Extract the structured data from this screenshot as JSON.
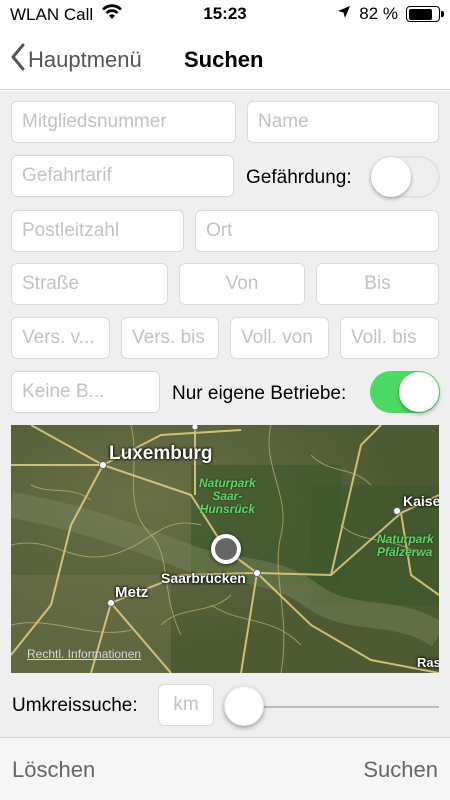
{
  "status_bar": {
    "carrier": "WLAN Call",
    "time": "15:23",
    "battery_text": "82 %",
    "battery_level": 0.82,
    "icons": [
      "wifi-icon",
      "location-arrow-icon",
      "battery-icon"
    ]
  },
  "nav": {
    "back_label": "Hauptmenü",
    "title": "Suchen"
  },
  "form": {
    "mitgliedsnummer_placeholder": "Mitgliedsnummer",
    "name_placeholder": "Name",
    "gefahrtarif_placeholder": "Gefahrtarif",
    "gefaehrdung_label": "Gefährdung:",
    "gefaehrdung_on": false,
    "postleitzahl_placeholder": "Postleitzahl",
    "ort_placeholder": "Ort",
    "strasse_placeholder": "Straße",
    "von_placeholder": "Von",
    "bis_placeholder": "Bis",
    "vers_von_placeholder": "Vers. v...",
    "vers_bis_placeholder": "Vers. bis",
    "voll_von_placeholder": "Voll. von",
    "voll_bis_placeholder": "Voll. bis",
    "keine_b_placeholder": "Keine B...",
    "nur_eigene_label": "Nur eigene Betriebe:",
    "nur_eigene_on": true
  },
  "map": {
    "labels": {
      "luxemburg": "Luxemburg",
      "saarbruecken": "Saarbrücken",
      "metz": "Metz",
      "kaise": "Kaise",
      "ras": "Ras"
    },
    "parks": {
      "saar_hunsrueck": "Naturpark\nSaar-\nHunsrück",
      "pfaelzerwald": "Naturpark\nPfälzerwa"
    },
    "legal_link": "Rechtl. Informationen"
  },
  "radius": {
    "label": "Umkreissuche:",
    "unit_placeholder": "km",
    "slider_value": 0
  },
  "toolbar": {
    "clear_label": "Löschen",
    "search_label": "Suchen"
  },
  "colors": {
    "toggle_on": "#4cd964",
    "background": "#efeff0"
  }
}
